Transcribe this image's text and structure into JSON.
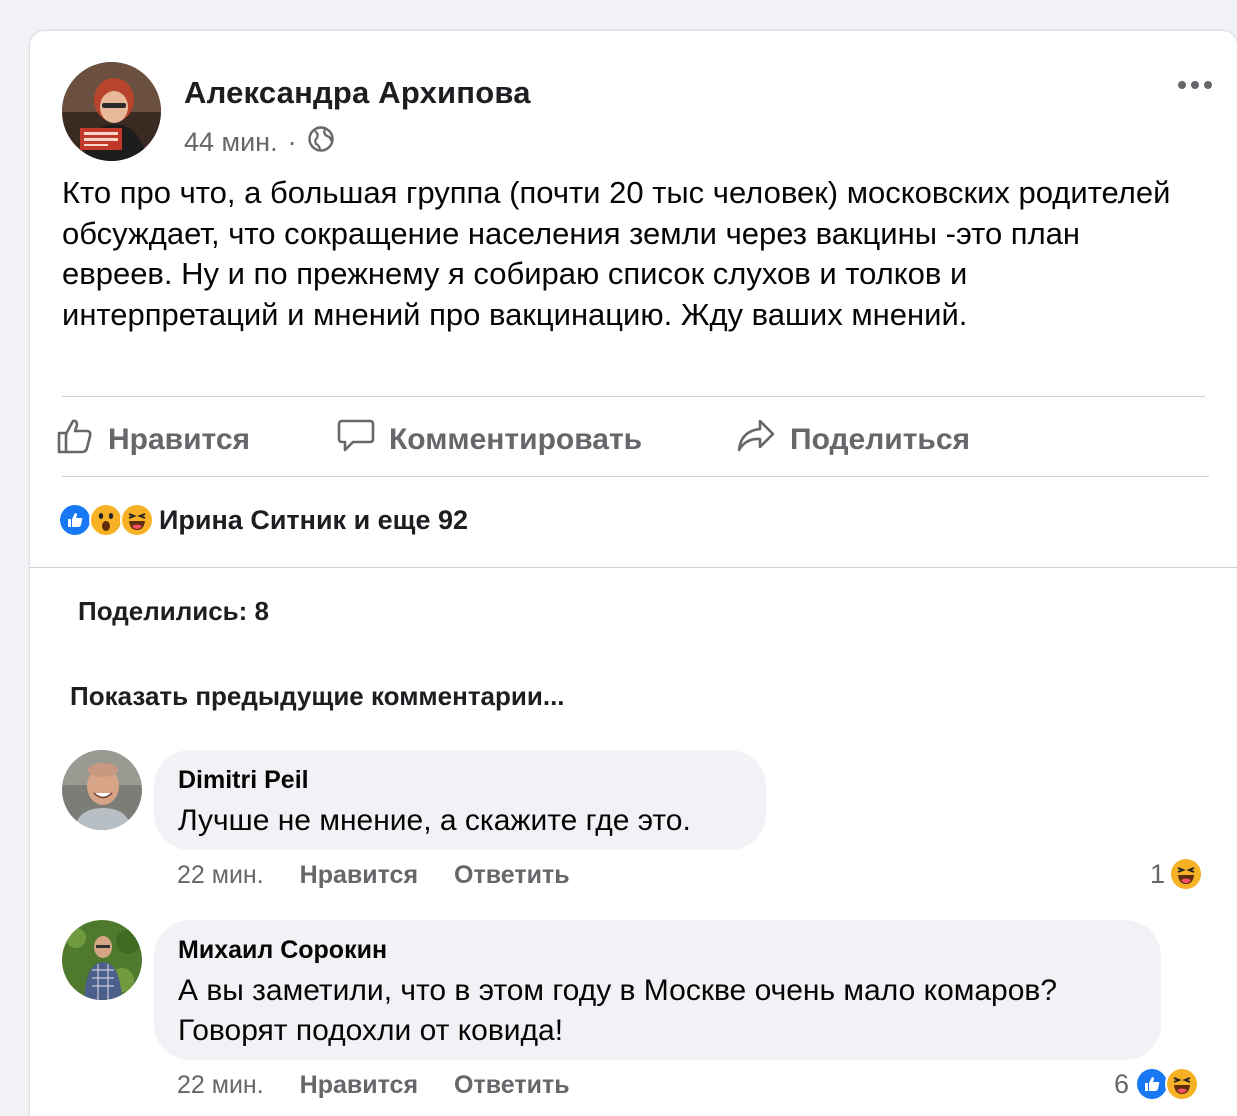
{
  "post": {
    "author": "Александра Архипова",
    "time": "44 мин.",
    "separator": "·",
    "text": "Кто про что, а большая группа (почти 20 тыс человек) московских родителей обсуждает, что сокращение населения земли через вакцины -это план евреев. Ну и по прежнему я собираю список слухов и толков и интерпретаций и мнений про вакцинацию. Жду ваших мнений.",
    "privacy_icon": "globe-icon"
  },
  "actions": {
    "like": "Нравится",
    "comment": "Комментировать",
    "share": "Поделиться"
  },
  "reactions": {
    "icons": [
      "like-reaction",
      "wow-reaction",
      "haha-reaction"
    ],
    "summary": "Ирина Ситник и еще 92"
  },
  "shares_label": "Поделились: 8",
  "show_previous": "Показать предыдущие комментарии...",
  "comments": [
    {
      "author": "Dimitri Peil",
      "text": "Лучше не мнение, а скажите где это.",
      "time": "22 мин.",
      "like": "Нравится",
      "reply": "Ответить",
      "reaction_count": "1",
      "reaction_icons": [
        "haha-reaction"
      ]
    },
    {
      "author": "Михаил Сорокин",
      "text_line1": "А вы заметили, что в этом году в Москве очень мало комаров?",
      "text_line2": "Говорят подохли от ковида!",
      "time": "22 мин.",
      "like": "Нравится",
      "reply": "Ответить",
      "reaction_count": "6",
      "reaction_icons": [
        "like-reaction",
        "haha-reaction"
      ]
    }
  ],
  "colors": {
    "like_blue": "#1877f2",
    "secondary_text": "#65676b",
    "bubble_bg": "#f0f2f5",
    "emoji_yellow": "#f7b125"
  }
}
